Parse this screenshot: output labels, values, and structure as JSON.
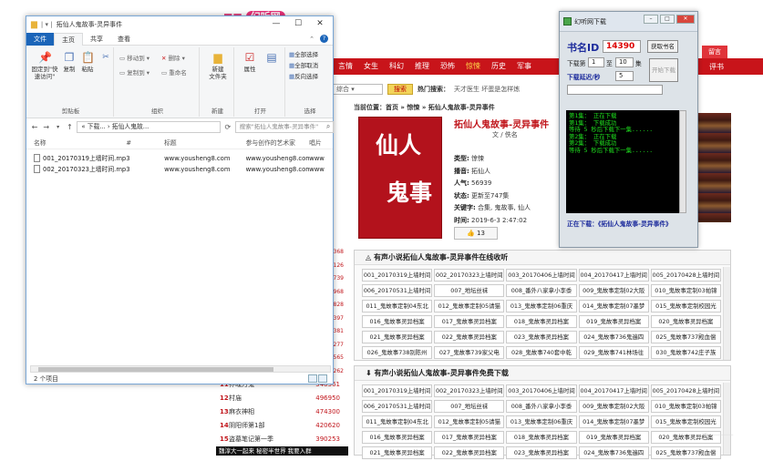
{
  "website": {
    "logo_text": "~",
    "login_tab": "留言",
    "review_tab": "评书",
    "categories": [
      "言情",
      "女生",
      "科幻",
      "推理",
      "恐怖",
      "惊悚",
      "历史",
      "军事"
    ],
    "active_category": "惊悚",
    "search": {
      "select_value": "综合",
      "button": "搜索",
      "hot_label": "热门搜索：",
      "hot_values": "天才医生  坏蛋是怎样炼"
    },
    "breadcrumb": "当前位置：首页  »  惊悚  »  拓仙人鬼故事-灵异事件",
    "book_title": "拓仙人鬼故事-灵异事件",
    "author_line": "文  /  佚名",
    "cover_line1": "仙人",
    "cover_line2": "鬼事",
    "info": [
      {
        "label": "类型:",
        "value": "惊悚"
      },
      {
        "label": "播音:",
        "value": "拓仙人"
      },
      {
        "label": "人气:",
        "value": "56939"
      },
      {
        "label": "状态:",
        "value": "更新至747集"
      },
      {
        "label": "关键字:",
        "value": "合集, 鬼故事, 仙人"
      },
      {
        "label": "时间:",
        "value": "2019-6-3  2:47:02"
      }
    ],
    "like_count": "13",
    "section1_title": "有声小说拓仙人鬼故事-灵异事件在线收听",
    "section2_title": "有声小说拓仙人鬼故事-灵异事件免费下载",
    "episodes": [
      "001_20170319上墙时间",
      "002_20170323上墙时间",
      "003_20170406上墙时间",
      "004_20170417上墙时间",
      "005_20170428上墙时间",
      "006_20170531上墙时间",
      "007_地坛丝袜",
      "008_番外八家拿小李黍",
      "009_鬼故事定制02大阪",
      "010_鬼故事定制03帕锦",
      "011_鬼故事定制04东北",
      "012_鬼故事定制05请猫",
      "013_鬼故事定制06重庆",
      "014_鬼故事定制07墨梦",
      "015_鬼故事定制校园光",
      "016_鬼故事灵异档案",
      "017_鬼故事灵异档案",
      "018_鬼故事灵异档案",
      "019_鬼故事灵异档案",
      "020_鬼故事灵异档案",
      "021_鬼故事灵异档案",
      "022_鬼故事灵异档案",
      "023_鬼故事灵异档案",
      "024_鬼故事736鬼遍四",
      "025_鬼故事737殿血偿",
      "026_鬼故事738别陈州",
      "027_鬼故事739家父电",
      "028_鬼故事740套中乾",
      "029_鬼故事741林场往",
      "030_鬼故事742庄子族"
    ],
    "episodes2": [
      "001_20170319上墙时间",
      "002_20170323上墙时间",
      "003_20170406上墙时间",
      "004_20170417上墙时间",
      "005_20170428上墙时间",
      "006_20170531上墙时间",
      "007_地坛丝袜",
      "008_番外八家拿小李黍",
      "009_鬼故事定制02大阪",
      "010_鬼故事定制03帕锦",
      "011_鬼故事定制04东北",
      "012_鬼故事定制05请猫",
      "013_鬼故事定制06重庆",
      "014_鬼故事定制07墨梦",
      "015_鬼故事定制校园光",
      "016_鬼故事灵异档案",
      "017_鬼故事灵异档案",
      "018_鬼故事灵异档案",
      "019_鬼故事灵异档案",
      "020_鬼故事灵异档案",
      "021_鬼故事灵异档案",
      "022_鬼故事灵异档案",
      "023_鬼故事灵异档案",
      "024_鬼故事736鬼遍四",
      "025_鬼故事737殿血偿"
    ],
    "left_counts": [
      "368",
      "126",
      "739",
      "968",
      "828",
      "397",
      "381",
      "277",
      "565",
      "262"
    ],
    "rank": [
      {
        "n": "11",
        "name": "养魂万鬼",
        "count": "540561"
      },
      {
        "n": "12",
        "name": "村庙",
        "count": "496950"
      },
      {
        "n": "13",
        "name": "麻衣神相",
        "count": "474300"
      },
      {
        "n": "14",
        "name": "阴阳师第1部",
        "count": "420620"
      },
      {
        "n": "15",
        "name": "盗墓笔记第一季",
        "count": "390253"
      }
    ],
    "bottom_text": "魏淳大一起来 秘密半世界   我要入群   "
  },
  "explorer": {
    "title": "拓仙人鬼故事-灵异事件",
    "tabs": [
      "文件",
      "主页",
      "共享",
      "查看"
    ],
    "ribbon": {
      "pin": "固定到\"快速访问\"",
      "copy": "复制",
      "paste": "粘贴",
      "move_to": "移动到",
      "copy_to": "复制到",
      "delete": "删除",
      "rename": "重命名",
      "new_folder": "新建\n文件夹",
      "properties": "属性",
      "select_all": "全部选择",
      "select_none": "全部取消",
      "invert": "反向选择",
      "groups": [
        "剪贴板",
        "组织",
        "新建",
        "打开",
        "选择"
      ]
    },
    "address": "« 下载... › 拓仙人鬼故...",
    "search_placeholder": "搜索\"拓仙人鬼故事-灵异事件\"",
    "columns": [
      "名称",
      "#",
      "标题",
      "参与创作的艺术家",
      "唱片"
    ],
    "files": [
      {
        "name": "001_20170319上墙时间.mp3",
        "artist": "www.yousheng8.com",
        "album": "www.yousheng8.com",
        "extra": "www"
      },
      {
        "name": "002_20170323上墙时间.mp3",
        "artist": "www.yousheng8.com",
        "album": "www.yousheng8.com",
        "extra": "www"
      }
    ],
    "status": "2 个项目"
  },
  "downloader": {
    "title": "幻听网下载",
    "book_id_label": "书名ID",
    "book_id": "14390",
    "get_name_button": "获取书名",
    "range_label": "下载第",
    "range_from": "1",
    "range_to_label": "至",
    "range_to": "10",
    "range_unit": "集",
    "delay_label": "下载延迟/秒",
    "delay": "5",
    "start_button": "开始下载",
    "progress_value": "",
    "console": "第1集： 正在下载\n第1集： 下载成功\n等待 5 秒后下载下一集......\n第2集： 正在下载\n第2集： 下载成功\n等待 5 秒后下载下一集......",
    "now_label": "正在下载：《拓仙人鬼故事-灵异事件》"
  }
}
